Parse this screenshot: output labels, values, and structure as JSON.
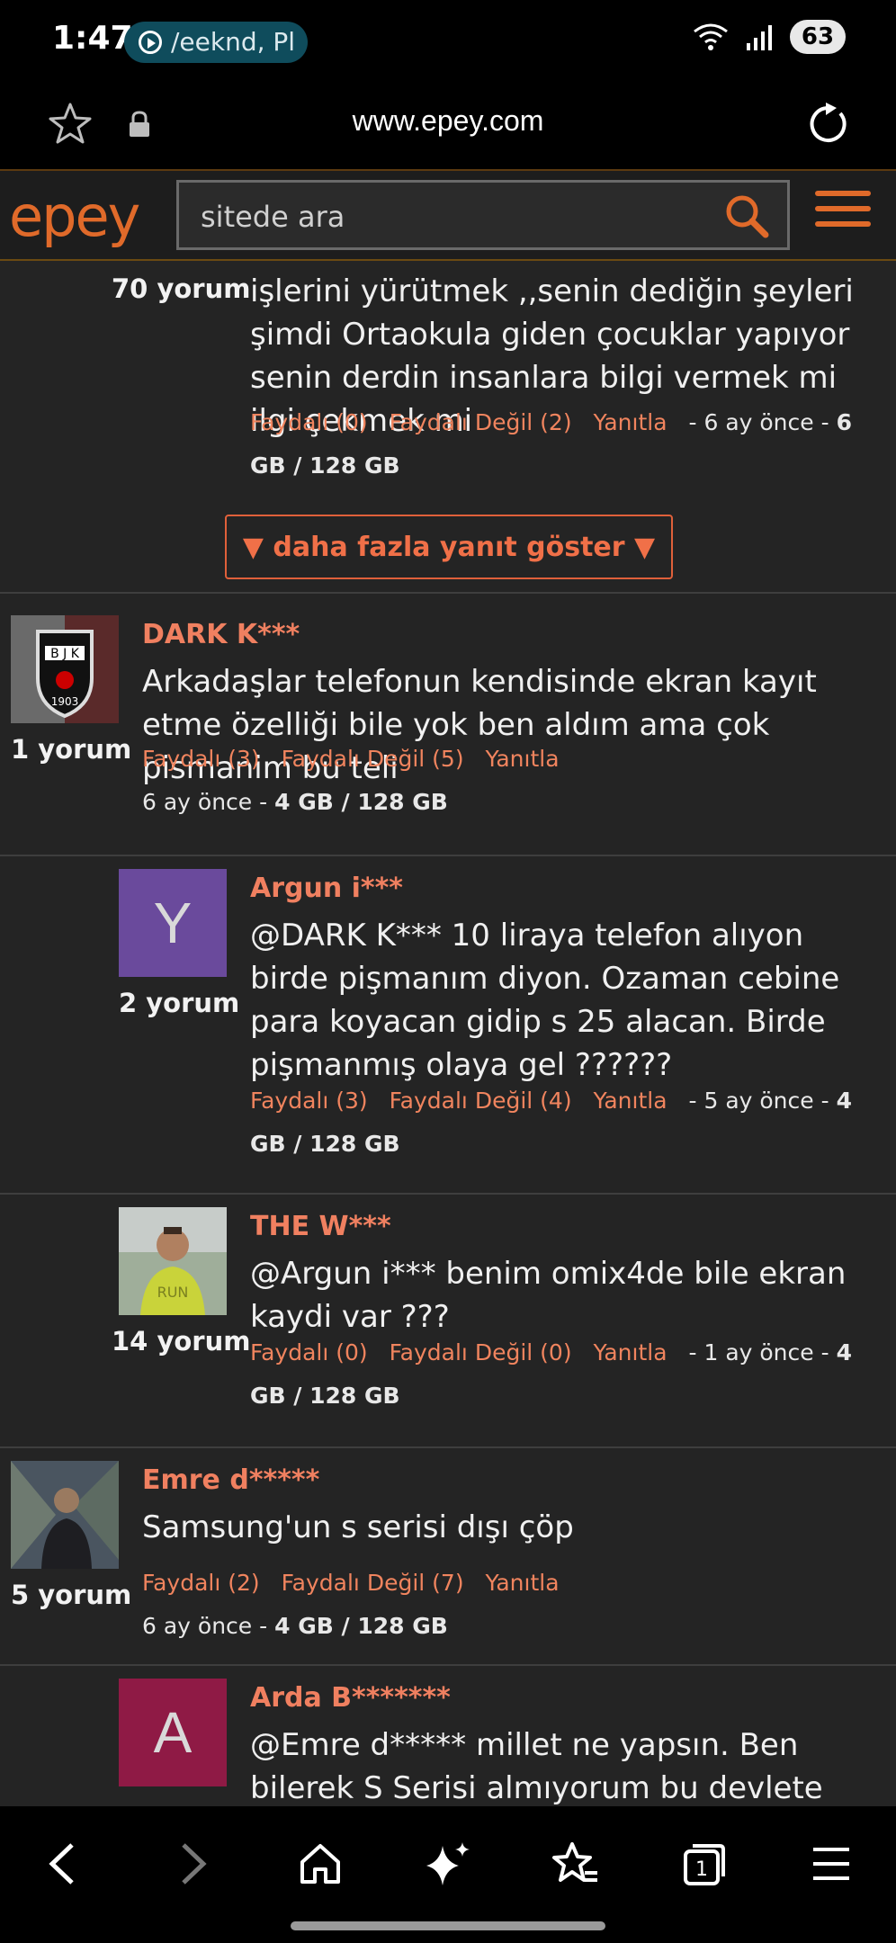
{
  "status_bar": {
    "time": "1:47",
    "media_text": "/eeknd, Pl",
    "battery": "63"
  },
  "browser": {
    "url": "www.epey.com"
  },
  "site": {
    "logo": "epey",
    "search_placeholder": "sitede ara"
  },
  "partial_comment": {
    "count": "70 yorum",
    "text": "işlerini yürütmek ,,senin dediğin şeyleri şimdi Ortaokula giden çocuklar yapıyor senin derdin insanlara bilgi vermek mi ilgi çekmek mi",
    "useful": "Faydalı (0)",
    "not_useful": "Faydalı Değil (2)",
    "reply": "Yanıtla",
    "time": "- 6 ay önce -",
    "spec": "6 GB / 128 GB"
  },
  "more_button": "▼ daha fazla yanıt göster ▼",
  "comments": [
    {
      "name": "DARK K***",
      "count": "1 yorum",
      "text": "Arkadaşlar telefonun kendisinde ekran kayıt etme özelliği bile yok ben aldım ama çok pismanim bu teli",
      "useful": "Faydalı (3)",
      "not_useful": "Faydalı Değil (5)",
      "reply": "Yanıtla",
      "time": "6 ay önce -",
      "spec": "4 GB / 128 GB",
      "avatar_text": "BJK 1903"
    },
    {
      "name": "Argun i***",
      "count": "2 yorum",
      "text": "@DARK K*** 10 liraya telefon alıyon birde pişmanım diyon. Ozaman cebine para koyacan gidip s 25 alacan. Birde pişmanmış olaya gel ??????",
      "useful": "Faydalı (3)",
      "not_useful": "Faydalı Değil (4)",
      "reply": "Yanıtla",
      "time": "- 5 ay önce -",
      "spec": "4 GB / 128 GB",
      "avatar_letter": "Y",
      "avatar_color": "#6a4a9c"
    },
    {
      "name": "THE W***",
      "count": "14 yorum",
      "text": "@Argun i*** benim omix4de bile ekran kaydi var ???",
      "useful": "Faydalı (0)",
      "not_useful": "Faydalı Değil (0)",
      "reply": "Yanıtla",
      "time": "- 1 ay önce -",
      "spec": "4 GB / 128 GB"
    },
    {
      "name": "Emre d*****",
      "count": "5 yorum",
      "text": "Samsung'un s serisi dışı çöp",
      "useful": "Faydalı (2)",
      "not_useful": "Faydalı Değil (7)",
      "reply": "Yanıtla",
      "time": "6 ay önce -",
      "spec": "4 GB / 128 GB"
    },
    {
      "name": "Arda B*******",
      "text": "@Emre d***** millet ne yapsın. Ben bilerek S Serisi almıyorum bu devlete vergi vermemek",
      "avatar_letter": "A",
      "avatar_color": "#8f1a45"
    }
  ],
  "colors": {
    "accent": "#e06a2a",
    "link": "#f0845e",
    "background": "#242424"
  },
  "bottom_nav_icons": [
    "back-icon",
    "forward-icon",
    "home-icon",
    "sparkle-icon",
    "bookmarks-icon",
    "tabs-icon",
    "menu-icon"
  ],
  "tabs_count": "1"
}
